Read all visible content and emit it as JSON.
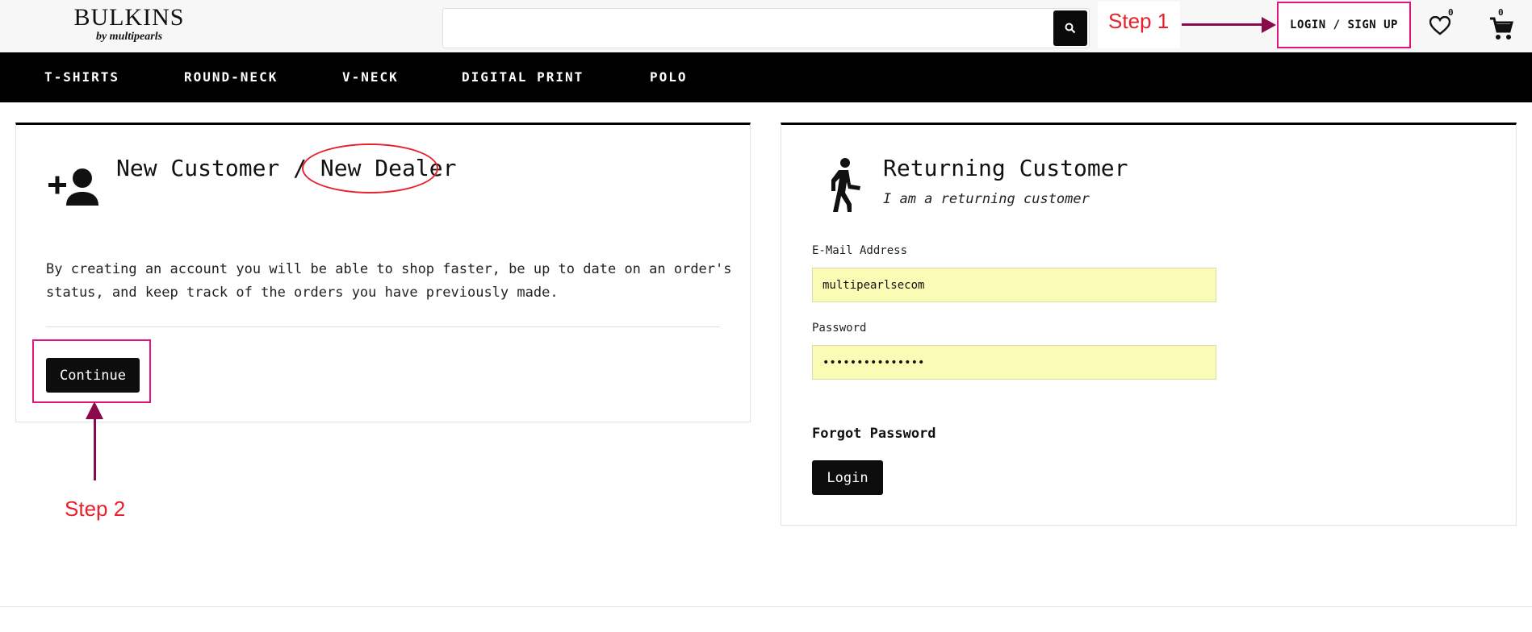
{
  "header": {
    "logo_main": "BULKINS",
    "logo_sub": "by multipearls",
    "search": {
      "placeholder": "",
      "value": ""
    },
    "login_signup_label": "LOGIN / SIGN UP",
    "wishlist_count": "0",
    "cart_count": "0"
  },
  "nav": {
    "items": [
      {
        "label": "T-SHIRTS"
      },
      {
        "label": "ROUND-NECK"
      },
      {
        "label": "V-NECK"
      },
      {
        "label": "DIGITAL PRINT"
      },
      {
        "label": "POLO"
      }
    ]
  },
  "new_customer": {
    "title_part1": "New Customer / ",
    "title_part2": "New Dealer",
    "description": "By creating an account you will be able to shop faster, be up to date on an order's status, and keep track of the orders you have previously made.",
    "continue_label": "Continue"
  },
  "returning_customer": {
    "title": "Returning Customer",
    "subtitle": "I am a returning customer",
    "email_label": "E-Mail Address",
    "email_value": "multipearlsecom",
    "password_label": "Password",
    "password_value": "•••••••••••••••",
    "forgot_label": "Forgot Password",
    "login_label": "Login"
  },
  "annotations": {
    "step1": "Step 1",
    "step2": "Step 2",
    "highlight_color": "#e0157e",
    "arrow_color": "#8b0a4a",
    "step_text_color": "#e8202a"
  }
}
